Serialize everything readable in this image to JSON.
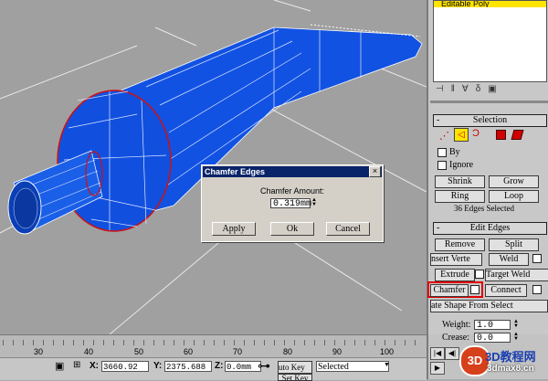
{
  "viewport": {
    "background": "#a0a0a0",
    "object_color": "#1455e0",
    "selected_edge_color": "#d01010"
  },
  "panel": {
    "modifier_stack_item": "Editable Poly",
    "selection": {
      "title": "Selection",
      "by_label": "By",
      "ignore_label": "Ignore",
      "shrink_label": "Shrink",
      "grow_label": "Grow",
      "ring_label": "Ring",
      "loop_label": "Loop",
      "status": "36 Edges Selected"
    },
    "edit_edges": {
      "title": "Edit Edges",
      "remove_label": "Remove",
      "split_label": "Split",
      "insert_vertex_label": "nsert Verte",
      "weld_label": "Weld",
      "extrude_label": "Extrude",
      "target_weld_label": "Target Weld",
      "chamfer_label": "Chamfer",
      "connect_label": "Connect",
      "create_shape_label": "ate Shape From Select",
      "weight_label": "Weight:",
      "weight_value": "1.0",
      "crease_label": "Crease:",
      "crease_value": "0.0"
    }
  },
  "dialog": {
    "title": "Chamfer Edges",
    "amount_label": "Chamfer Amount:",
    "amount_value": "0.319mm",
    "apply_label": "Apply",
    "ok_label": "Ok",
    "cancel_label": "Cancel",
    "close_glyph": "×"
  },
  "timeline": {
    "ticks": [
      "30",
      "40",
      "50",
      "60",
      "70",
      "80",
      "90",
      "100"
    ]
  },
  "status": {
    "x_label": "X:",
    "x_value": "3660.92",
    "y_label": "Y:",
    "y_value": "2375.688",
    "z_label": "Z:",
    "z_value": "0.0mm",
    "auto_key_label": "uto Key",
    "selected_value": "Selected",
    "set_key_label": "Set Key"
  },
  "watermark": {
    "line1": "3D教程网",
    "line2": "3dmax8.cn"
  }
}
